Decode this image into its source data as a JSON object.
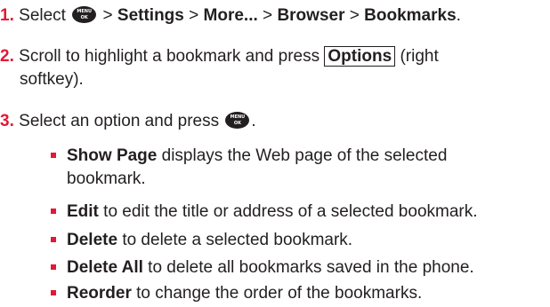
{
  "steps": [
    {
      "number": "1.",
      "text_before": "Select",
      "sep1": ">",
      "path1": "Settings",
      "sep2": ">",
      "path2": "More...",
      "sep3": ">",
      "path3": "Browser",
      "sep4": ">",
      "path4": "Bookmarks",
      "end": "."
    },
    {
      "number": "2.",
      "text_before": "Scroll to highlight a bookmark and press",
      "softkey": "Options",
      "text_after_line1": "(right",
      "text_line2": "softkey)."
    },
    {
      "number": "3.",
      "text_before": "Select an option and press",
      "end": "."
    }
  ],
  "menu_key": {
    "top": "MENU",
    "bottom": "OK",
    "icon": "menu-ok-key-icon"
  },
  "options": [
    {
      "term": "Show Page",
      "desc_line1": "displays the Web page of the selected",
      "desc_line2": "bookmark."
    },
    {
      "term": "Edit",
      "desc": "to edit the title or address of a selected bookmark."
    },
    {
      "term": "Delete",
      "desc": "to delete a selected bookmark."
    },
    {
      "term": "Delete All",
      "desc": "to delete all bookmarks saved in the phone."
    },
    {
      "term": "Reorder",
      "desc": "to change the order of the bookmarks."
    }
  ],
  "colors": {
    "accent": "#e31837",
    "text": "#231f20"
  }
}
